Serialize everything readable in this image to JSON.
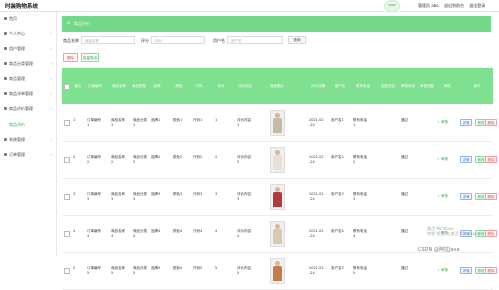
{
  "app": {
    "title": "时装购物系统"
  },
  "top": {
    "logo_text": "SHOP",
    "user_text": "管理员 abo",
    "front_link": "退出到前台",
    "logout_link": "退出登录"
  },
  "sidebar": {
    "items": [
      {
        "label": "首页",
        "arrow": ""
      },
      {
        "label": "个人中心",
        "arrow": "›"
      },
      {
        "label": "用户管理",
        "arrow": "›"
      },
      {
        "label": "商品分类管理",
        "arrow": "›"
      },
      {
        "label": "商品管理",
        "arrow": "›"
      },
      {
        "label": "商品详单管理",
        "arrow": "›"
      },
      {
        "label": "商品评价管理",
        "arrow": "›"
      },
      {
        "label": "系统管理",
        "arrow": "›"
      },
      {
        "label": "订单管理",
        "arrow": "›"
      }
    ],
    "active_sub": "商品评价"
  },
  "breadcrumb": {
    "home_icon": "⌂",
    "text": "商品评价"
  },
  "search": {
    "field1_label": "商品名称",
    "field1_placeholder": "商品名称",
    "field2_label": "评分",
    "field2_placeholder": "评分",
    "field3_label": "用户名",
    "field3_placeholder": "用户名",
    "button_label": "查询"
  },
  "actions": {
    "delete_label": "删除",
    "export_label": "批量导出"
  },
  "table": {
    "headers": [
      "",
      "索引",
      "订单编号",
      "商品名称",
      "商品类型",
      "品牌",
      "颜色",
      "尺码",
      "评分",
      "评价内容",
      "商品图片",
      "评价日期",
      "用户名",
      "联系电话",
      "回复内容",
      "审核状态",
      "审核回复",
      "审核",
      "操作"
    ],
    "rows": [
      {
        "index": "1",
        "order": "订单编号\n1",
        "name": "商品名称\n1",
        "type": "商品分类\n1",
        "brand": "品牌1",
        "color": "颜色1",
        "size": "尺码1",
        "score": "1",
        "content": "评价内容\n1",
        "date": "2021-02\n-24",
        "user": "用户名1",
        "phone": "联系电话\n1",
        "audit": "通过",
        "pay": "✓ 审核"
      },
      {
        "index": "2",
        "order": "订单编号\n2",
        "name": "商品名称\n2",
        "type": "商品分类\n2",
        "brand": "品牌2",
        "color": "颜色2",
        "size": "尺码2",
        "score": "2",
        "content": "评价内容\n2",
        "date": "2021-02\n-24",
        "user": "用户名2",
        "phone": "联系电话\n2",
        "audit": "通过",
        "pay": "✓ 审核"
      },
      {
        "index": "3",
        "order": "订单编号\n3",
        "name": "商品名称\n3",
        "type": "商品分类\n3",
        "brand": "品牌3",
        "color": "颜色3",
        "size": "尺码3",
        "score": "3",
        "content": "评价内容\n3",
        "date": "2021-02\n-24",
        "user": "用户名3",
        "phone": "联系电话\n3",
        "audit": "通过",
        "pay": "✓ 审核"
      },
      {
        "index": "4",
        "order": "订单编号\n4",
        "name": "商品名称\n4",
        "type": "商品分类\n4",
        "brand": "品牌4",
        "color": "颜色4",
        "size": "尺码4",
        "score": "4",
        "content": "评价内容\n4",
        "date": "2021-02\n-24",
        "user": "用户名4",
        "phone": "联系电话\n4",
        "audit": "通过",
        "pay": "✓ 审核"
      },
      {
        "index": "5",
        "order": "订单编号\n5",
        "name": "商品名称\n5",
        "type": "商品分类\n5",
        "brand": "品牌5",
        "color": "颜色5",
        "size": "尺码5",
        "score": "5",
        "content": "评价内容\n5",
        "date": "2021-02\n-24",
        "user": "用户名5",
        "phone": "联系电话\n5",
        "audit": "通过",
        "pay": "✓ 审核"
      }
    ],
    "row_buttons": {
      "detail": "详情",
      "edit": "修改",
      "delete": "删除"
    },
    "thumb_colors": [
      "#c9b8a5",
      "#e8e0d6",
      "#b23a3a",
      "#d9c9b0",
      "#c27b4a"
    ]
  },
  "watermark": {
    "line1": "激活 Windows",
    "line2": "转到\"设置\"以激活 Windows。"
  },
  "credit": "CSDN @阿拉Java",
  "colors": {
    "accent": "#73d88a",
    "header": "#7fe090"
  }
}
